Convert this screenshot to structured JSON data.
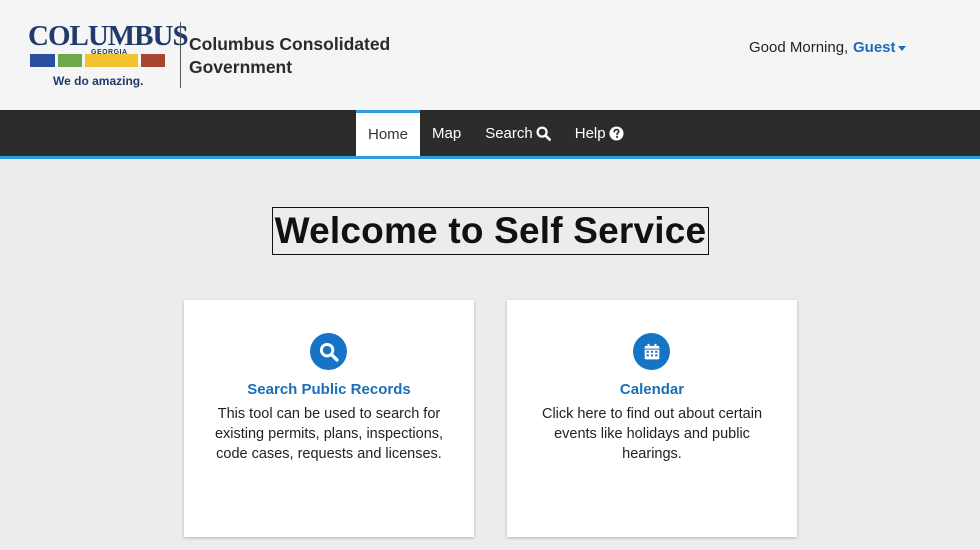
{
  "header": {
    "logo": {
      "wordmark": "COLUMBUS",
      "sub": "GEORGIA",
      "tagline": "We do amazing.",
      "bar_colors": [
        "#2a4fa0",
        "#6fa84a",
        "#f2c230",
        "#a94432"
      ]
    },
    "org_name": "Columbus Consolidated Government",
    "greeting": "Good Morning,",
    "user": "Guest"
  },
  "nav": {
    "items": [
      {
        "label": "Home",
        "active": true,
        "icon": ""
      },
      {
        "label": "Map",
        "active": false,
        "icon": ""
      },
      {
        "label": "Search",
        "active": false,
        "icon": "search-icon"
      },
      {
        "label": "Help",
        "active": false,
        "icon": "question-circle-icon"
      }
    ]
  },
  "main": {
    "title": "Welcome to Self Service",
    "cards": [
      {
        "title": "Search Public Records",
        "description": "This tool can be used to search for existing permits, plans, inspections, code cases, requests and licenses.",
        "icon": "search-icon"
      },
      {
        "title": "Calendar",
        "description": "Click here to find out about certain events like holidays and public hearings.",
        "icon": "calendar-icon"
      }
    ]
  },
  "colors": {
    "accent": "#1a6fb8",
    "nav_bg": "#2e2c2b",
    "nav_border": "#2b9de0",
    "icon_bg": "#1674c6"
  }
}
